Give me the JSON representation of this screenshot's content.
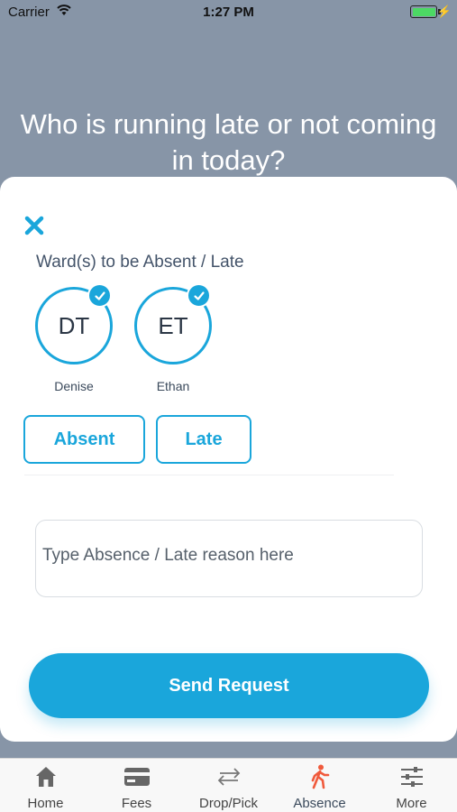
{
  "status_bar": {
    "carrier": "Carrier",
    "time": "1:27 PM"
  },
  "prompt": {
    "question": "Who is running late or not coming in today?"
  },
  "form": {
    "section_label": "Ward(s) to be Absent / Late",
    "wards": [
      {
        "initials": "DT",
        "name": "Denise",
        "selected": true
      },
      {
        "initials": "ET",
        "name": "Ethan",
        "selected": true
      }
    ],
    "type_options": [
      {
        "label": "Absent"
      },
      {
        "label": "Late"
      }
    ],
    "reason_placeholder": "Type Absence  / Late reason here",
    "submit_label": "Send Request"
  },
  "tab_bar": {
    "items": [
      {
        "label": "Home",
        "icon": "home-icon"
      },
      {
        "label": "Fees",
        "icon": "card-icon"
      },
      {
        "label": "Drop/Pick",
        "icon": "swap-arrows-icon"
      },
      {
        "label": "Absence",
        "icon": "walking-person-icon",
        "active": true
      },
      {
        "label": "More",
        "icon": "sliders-icon"
      }
    ]
  },
  "colors": {
    "accent": "#1aa6db",
    "backdrop": "#8795a7",
    "active_tab_icon": "#f05a3c",
    "battery": "#4cd964"
  }
}
